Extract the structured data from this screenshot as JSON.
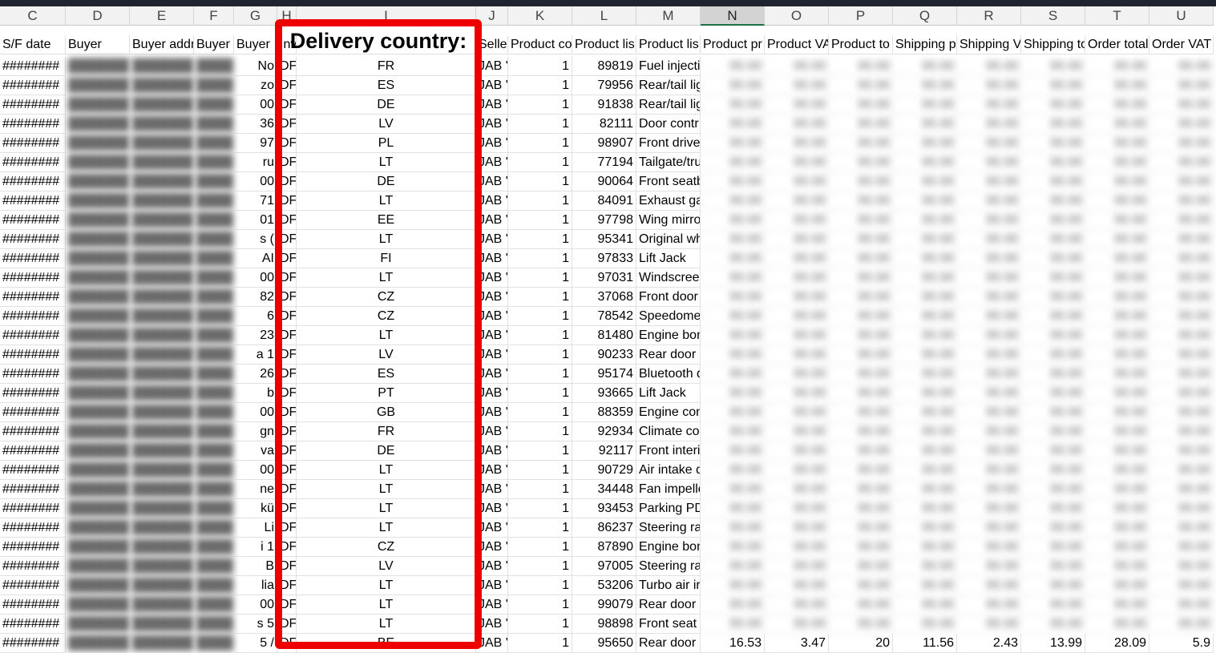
{
  "app": {
    "name": "Spreadsheet"
  },
  "columns": [
    "C",
    "D",
    "E",
    "F",
    "G",
    "H",
    "I",
    "J",
    "K",
    "L",
    "M",
    "N",
    "O",
    "P",
    "Q",
    "R",
    "S",
    "T",
    "U"
  ],
  "selected_column": "N",
  "headers": {
    "C": "S/F date",
    "D": "Buyer",
    "E": "Buyer addr",
    "F": "Buyer c",
    "G": "Buyer",
    "H": "Inv",
    "I": "",
    "J": "Selle",
    "K": "Product co",
    "L": "Product lis",
    "M": "Product lis",
    "N": "Product pr",
    "O": "Product VA",
    "P": "Product to",
    "Q": "Shipping pr",
    "R": "Shipping V",
    "S": "Shipping to",
    "T": "Order total",
    "U": "Order VAT"
  },
  "highlight": {
    "title": "Delivery country:",
    "border_color": "#ee0000"
  },
  "rows": [
    {
      "date": "########",
      "g": "No",
      "h": "DF",
      "country": "FR",
      "j": "JAB '",
      "qty": "1",
      "list_no": "89819",
      "product": "Fuel injecti"
    },
    {
      "date": "########",
      "g": "zo",
      "h": "DF",
      "country": "ES",
      "j": "JAB '",
      "qty": "1",
      "list_no": "79956",
      "product": "Rear/tail lig"
    },
    {
      "date": "########",
      "g": "00",
      "h": "DF",
      "country": "DE",
      "j": "JAB '",
      "qty": "1",
      "list_no": "91838",
      "product": "Rear/tail lig"
    },
    {
      "date": "########",
      "g": "36",
      "h": "DF",
      "country": "LV",
      "j": "JAB '",
      "qty": "1",
      "list_no": "82111",
      "product": "Door contr"
    },
    {
      "date": "########",
      "g": "97",
      "h": "DF",
      "country": "PL",
      "j": "JAB '",
      "qty": "1",
      "list_no": "98907",
      "product": "Front drive"
    },
    {
      "date": "########",
      "g": "ru",
      "h": "DF",
      "country": "LT",
      "j": "JAB '",
      "qty": "1",
      "list_no": "77194",
      "product": "Tailgate/tru"
    },
    {
      "date": "########",
      "g": "00",
      "h": "DF",
      "country": "DE",
      "j": "JAB '",
      "qty": "1",
      "list_no": "90064",
      "product": "Front seatb"
    },
    {
      "date": "########",
      "g": "71",
      "h": "DF",
      "country": "LT",
      "j": "JAB '",
      "qty": "1",
      "list_no": "84091",
      "product": "Exhaust ga"
    },
    {
      "date": "########",
      "g": "01",
      "h": "DF",
      "country": "EE",
      "j": "JAB '",
      "qty": "1",
      "list_no": "97798",
      "product": "Wing mirro"
    },
    {
      "date": "########",
      "g": "s (",
      "h": "DF",
      "country": "LT",
      "j": "JAB '",
      "qty": "1",
      "list_no": "95341",
      "product": "Original wh"
    },
    {
      "date": "########",
      "g": "AI",
      "h": "DF",
      "country": "FI",
      "j": "JAB '",
      "qty": "1",
      "list_no": "97833",
      "product": "Lift Jack"
    },
    {
      "date": "########",
      "g": "00",
      "h": "DF",
      "country": "LT",
      "j": "JAB '",
      "qty": "1",
      "list_no": "97031",
      "product": "Windscree"
    },
    {
      "date": "########",
      "g": "82",
      "h": "DF",
      "country": "CZ",
      "j": "JAB '",
      "qty": "1",
      "list_no": "37068",
      "product": "Front door"
    },
    {
      "date": "########",
      "g": "6",
      "h": "DF",
      "country": "CZ",
      "j": "JAB '",
      "qty": "1",
      "list_no": "78542",
      "product": "Speedome"
    },
    {
      "date": "########",
      "g": "23",
      "h": "DF",
      "country": "LT",
      "j": "JAB '",
      "qty": "1",
      "list_no": "81480",
      "product": "Engine bon"
    },
    {
      "date": "########",
      "g": "a 1",
      "h": "DF",
      "country": "LV",
      "j": "JAB '",
      "qty": "1",
      "list_no": "90233",
      "product": "Rear door s"
    },
    {
      "date": "########",
      "g": "26",
      "h": "DF",
      "country": "ES",
      "j": "JAB '",
      "qty": "1",
      "list_no": "95174",
      "product": "Bluetooth d"
    },
    {
      "date": "########",
      "g": "b",
      "h": "DF",
      "country": "PT",
      "j": "JAB '",
      "qty": "1",
      "list_no": "93665",
      "product": "Lift Jack"
    },
    {
      "date": "########",
      "g": "00",
      "h": "DF",
      "country": "GB",
      "j": "JAB '",
      "qty": "1",
      "list_no": "88359",
      "product": "Engine con"
    },
    {
      "date": "########",
      "g": "gn",
      "h": "DF",
      "country": "FR",
      "j": "JAB '",
      "qty": "1",
      "list_no": "92934",
      "product": "Climate co"
    },
    {
      "date": "########",
      "g": "va",
      "h": "DF",
      "country": "DE",
      "j": "JAB '",
      "qty": "1",
      "list_no": "92117",
      "product": "Front interi"
    },
    {
      "date": "########",
      "g": "00",
      "h": "DF",
      "country": "LT",
      "j": "JAB '",
      "qty": "1",
      "list_no": "90729",
      "product": "Air intake d"
    },
    {
      "date": "########",
      "g": "ne",
      "h": "DF",
      "country": "LT",
      "j": "JAB '",
      "qty": "1",
      "list_no": "34448",
      "product": "Fan impelle"
    },
    {
      "date": "########",
      "g": "kü",
      "h": "DF",
      "country": "LT",
      "j": "JAB '",
      "qty": "1",
      "list_no": "93453",
      "product": "Parking PD"
    },
    {
      "date": "########",
      "g": "Li",
      "h": "DF",
      "country": "LT",
      "j": "JAB '",
      "qty": "1",
      "list_no": "86237",
      "product": "Steering ra"
    },
    {
      "date": "########",
      "g": "i 1",
      "h": "DF",
      "country": "CZ",
      "j": "JAB '",
      "qty": "1",
      "list_no": "87890",
      "product": "Engine bon"
    },
    {
      "date": "########",
      "g": "B",
      "h": "DF",
      "country": "LV",
      "j": "JAB '",
      "qty": "1",
      "list_no": "97005",
      "product": "Steering ra"
    },
    {
      "date": "########",
      "g": "lia",
      "h": "DF",
      "country": "LT",
      "j": "JAB '",
      "qty": "1",
      "list_no": "53206",
      "product": "Turbo air ir"
    },
    {
      "date": "########",
      "g": "00",
      "h": "DF",
      "country": "LT",
      "j": "JAB '",
      "qty": "1",
      "list_no": "99079",
      "product": "Rear door g"
    },
    {
      "date": "########",
      "g": "s 5",
      "h": "DF",
      "country": "LT",
      "j": "JAB '",
      "qty": "1",
      "list_no": "98898",
      "product": "Front seat"
    },
    {
      "date": "########",
      "g": "5 /",
      "h": "DF",
      "country": "BE",
      "j": "JAB '",
      "qty": "1",
      "list_no": "95650",
      "product": "Rear door s",
      "n": "16.53",
      "o": "3.47",
      "p": "20",
      "q": "11.56",
      "r": "2.43",
      "s": "13.99",
      "t": "28.09",
      "u": "5.9"
    }
  ],
  "blur_placeholder": "00.00"
}
